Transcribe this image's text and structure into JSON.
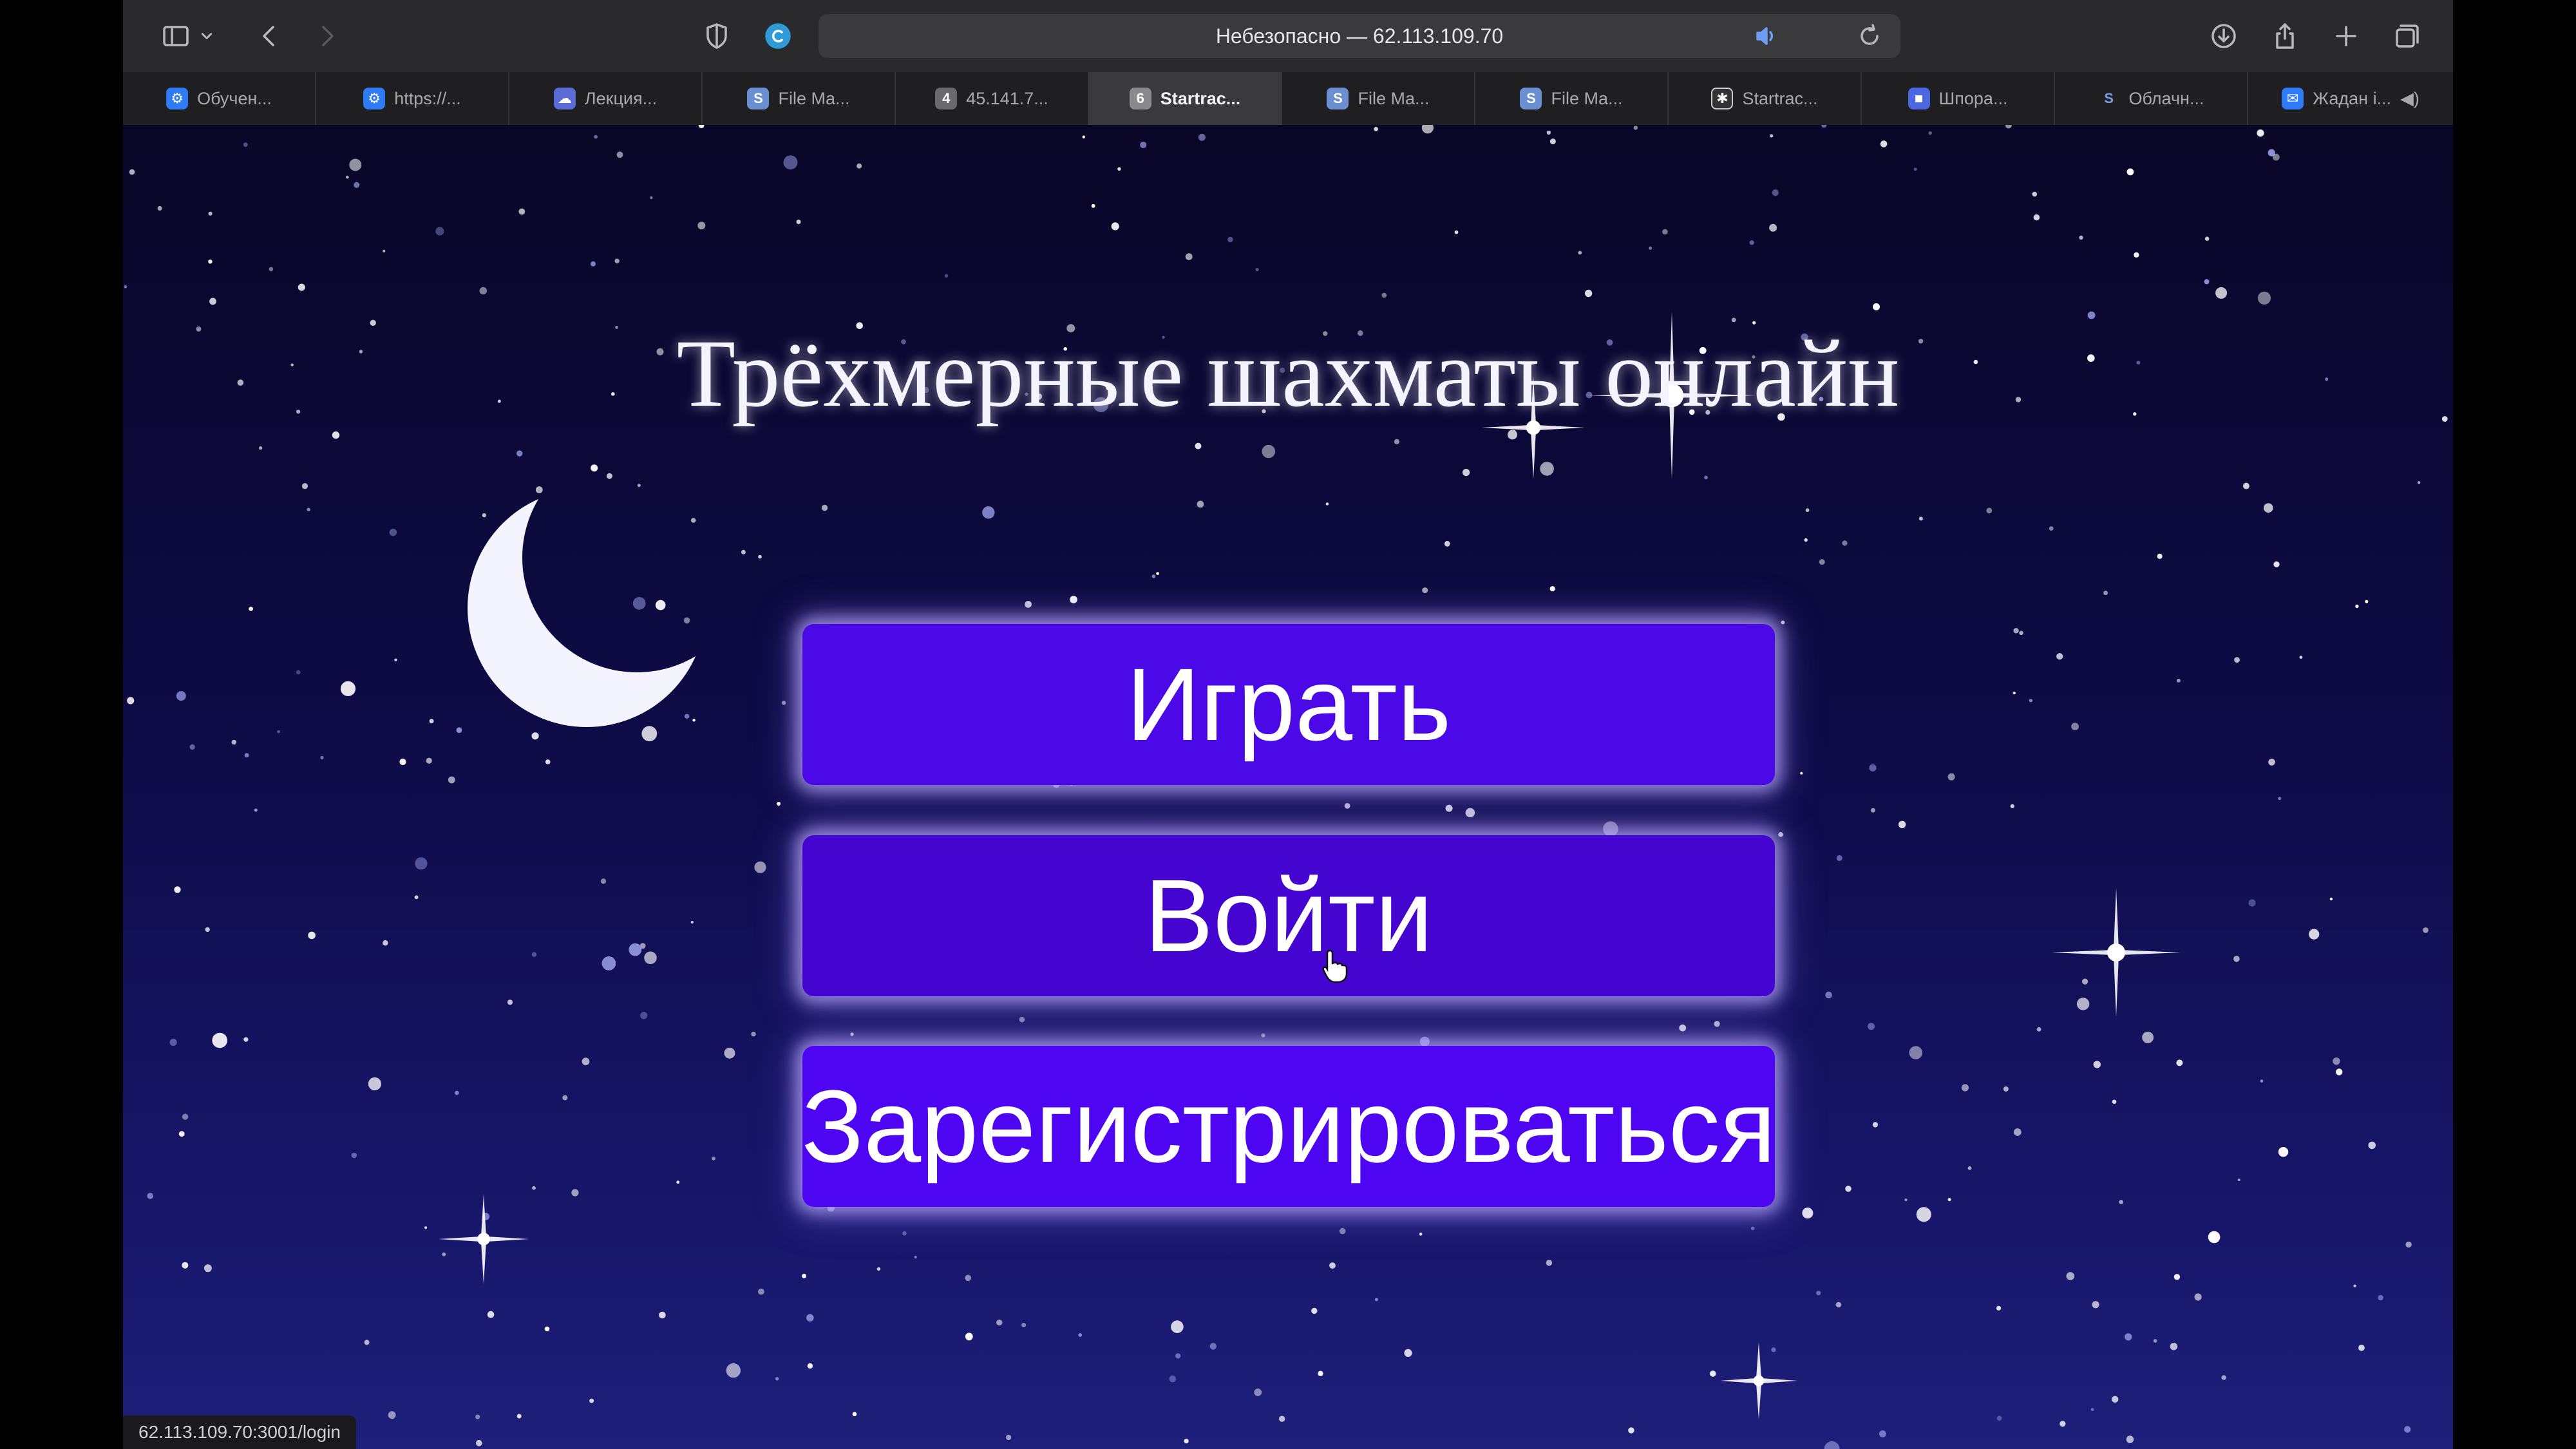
{
  "browser": {
    "address": "Небезопасно — 62.113.109.70",
    "tabs": [
      {
        "label": "Обучен...",
        "icon": "gear-favicon",
        "color": "#2f7bf6"
      },
      {
        "label": "https://...",
        "icon": "gear-favicon",
        "color": "#2f7bf6"
      },
      {
        "label": "Лекция...",
        "icon": "cloud-favicon",
        "color": "#5b6bd6"
      },
      {
        "label": "File Ma...",
        "icon": "s-favicon",
        "color": "#6c8fd0"
      },
      {
        "label": "45.141.7...",
        "icon": "number-favicon",
        "badge": "4",
        "color": "#6a6a6e"
      },
      {
        "label": "Startrac...",
        "icon": "number-favicon",
        "badge": "6",
        "color": "#8a8a8e",
        "active": true
      },
      {
        "label": "File Ma...",
        "icon": "s-favicon",
        "color": "#6c8fd0"
      },
      {
        "label": "File Ma...",
        "icon": "s-favicon",
        "color": "#6c8fd0"
      },
      {
        "label": "Startrac...",
        "icon": "app-favicon",
        "color": "#333336"
      },
      {
        "label": "Шпора...",
        "icon": "cube-favicon",
        "color": "#4b68e0"
      },
      {
        "label": "Облачн...",
        "icon": "s-favicon",
        "color": "#7d9be0"
      },
      {
        "label": "Жадан і...",
        "icon": "chat-favicon",
        "color": "#2f7bf6"
      }
    ],
    "status_url": "62.113.109.70:3001/login"
  },
  "page": {
    "title": "Трёхмерные шахматы онлайн",
    "buttons": {
      "play": "Играть",
      "login": "Войти",
      "register": "Зарегистрироваться"
    }
  },
  "colors": {
    "accent_button": "#4a09e6",
    "background_top": "#090627",
    "background_bottom": "#1d1f7a"
  }
}
